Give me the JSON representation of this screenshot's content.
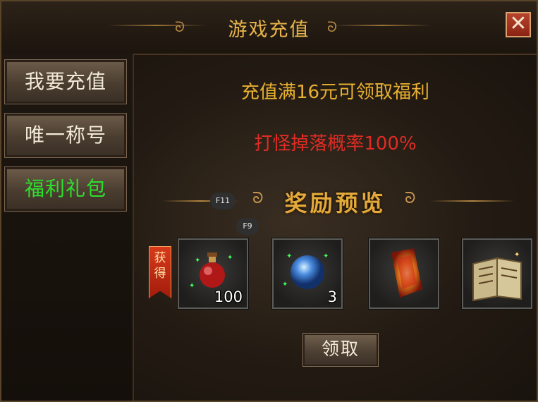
{
  "window": {
    "title": "游戏充值",
    "close_label": "✕"
  },
  "sidebar": {
    "items": [
      {
        "label": "我要充值",
        "active": false
      },
      {
        "label": "唯一称号",
        "active": false
      },
      {
        "label": "福利礼包",
        "active": true
      }
    ]
  },
  "main": {
    "headline": "充值满16元可领取福利",
    "subline": "打怪掉落概率100%",
    "preview_title": "奖励预览",
    "hotkeys": [
      "F11",
      "F9"
    ],
    "obtain_label": "获得",
    "rewards": [
      {
        "icon": "red-potion-icon",
        "count": "100"
      },
      {
        "icon": "blue-orb-icon",
        "count": "3"
      },
      {
        "icon": "fire-scroll-icon",
        "count": ""
      },
      {
        "icon": "skill-book-icon",
        "count": ""
      }
    ],
    "claim_label": "领取"
  },
  "colors": {
    "accent_gold": "#e8b030",
    "alert_red": "#e02c24",
    "active_green": "#2ee02e"
  }
}
